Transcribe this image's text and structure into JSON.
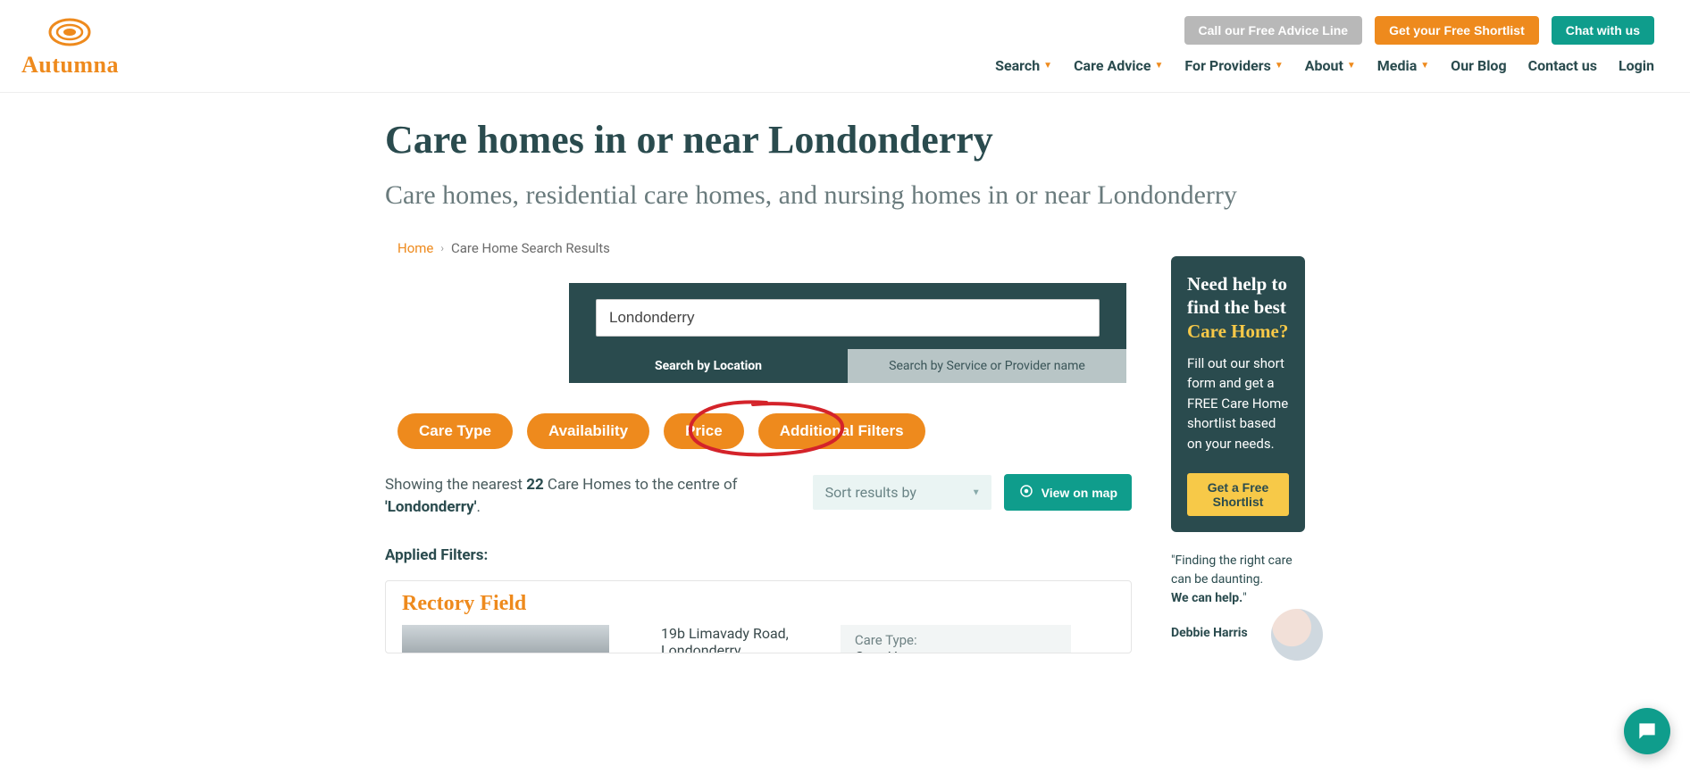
{
  "header": {
    "brand": "Autumna",
    "top_buttons": {
      "advice": "Call our Free Advice Line",
      "shortlist": "Get your Free Shortlist",
      "chat": "Chat with us"
    },
    "nav": {
      "search": "Search",
      "care_advice": "Care Advice",
      "for_providers": "For Providers",
      "about": "About",
      "media": "Media",
      "blog": "Our Blog",
      "contact": "Contact us",
      "login": "Login"
    }
  },
  "page": {
    "title": "Care homes in or near Londonderry",
    "subtitle": "Care homes, residential care homes, and nursing homes in or near Londonderry"
  },
  "breadcrumb": {
    "home": "Home",
    "current": "Care Home Search Results"
  },
  "search": {
    "value": "Londonderry",
    "tab_location": "Search by Location",
    "tab_provider": "Search by Service or Provider name"
  },
  "filters": {
    "care_type": "Care Type",
    "availability": "Availability",
    "price": "Price",
    "additional": "Additional Filters"
  },
  "results": {
    "prefix": "Showing the nearest ",
    "count": "22",
    "mid": " Care Homes to the centre of ",
    "location": "'Londonderry'",
    "suffix": ".",
    "sort_label": "Sort results by",
    "map_button": "View on map",
    "applied_label": "Applied Filters:"
  },
  "card": {
    "title": "Rectory Field",
    "address_line1": "19b Limavady Road,",
    "address_line2": "Londonderry",
    "care_type_label": "Care Type:",
    "care_type_value": "Care Home"
  },
  "sidebar": {
    "help": {
      "line1": "Need help to find the best",
      "line2": "Care Home?",
      "body": "Fill out our short form and get a FREE Care Home shortlist based on your needs.",
      "button": "Get a Free Shortlist"
    },
    "quote": {
      "line1": "\"Finding the right care can be daunting.",
      "line2": "We can help.",
      "end": "\"",
      "name": "Debbie Harris"
    }
  }
}
